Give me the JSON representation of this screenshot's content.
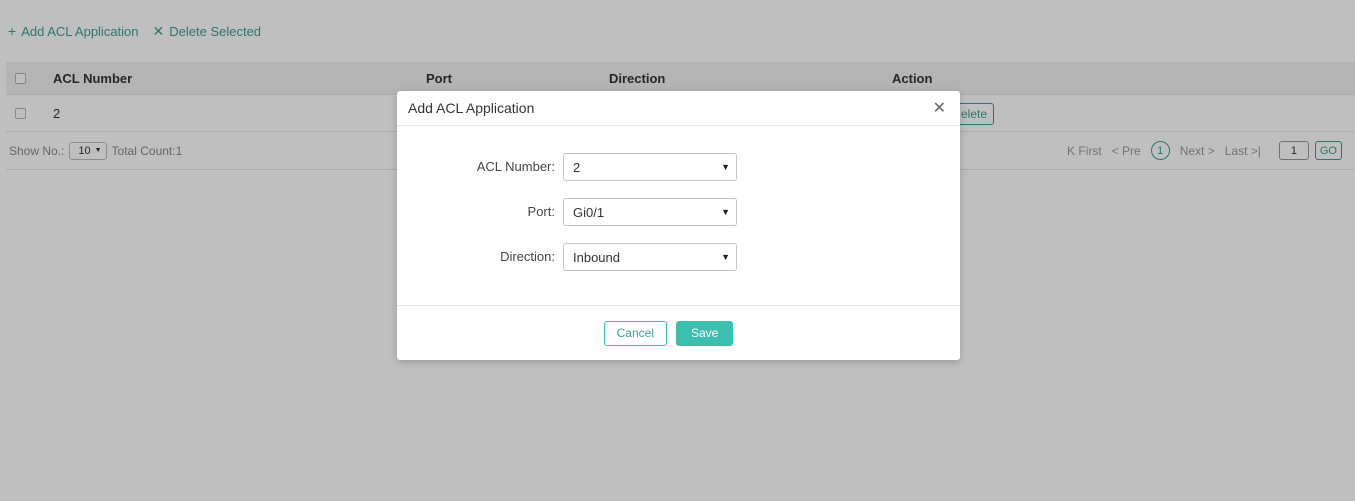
{
  "toolbar": {
    "add_icon": "+",
    "add_label": "Add ACL Application",
    "delete_icon": "✕",
    "delete_label": "Delete Selected"
  },
  "table": {
    "headers": [
      "ACL Number",
      "Port",
      "Direction",
      "Action"
    ],
    "rows": [
      {
        "acl_number": "2",
        "action_label": "elete"
      }
    ]
  },
  "pager": {
    "show_label": "Show No.:",
    "page_size": "10",
    "total": "Total Count:1",
    "first": "K First",
    "pre": "< Pre",
    "current": "1",
    "next": "Next >",
    "last": "Last >|",
    "input_value": "1",
    "go": "GO"
  },
  "modal": {
    "title": "Add ACL Application",
    "close_icon": "✕",
    "fields": [
      {
        "label": "ACL Number:",
        "value": "2"
      },
      {
        "label": "Port:",
        "value": "Gi0/1"
      },
      {
        "label": "Direction:",
        "value": "Inbound"
      }
    ],
    "cancel": "Cancel",
    "save": "Save"
  },
  "colors": {
    "accent": "#3b9e93",
    "save_bg": "#3bbfae"
  },
  "icons": {
    "dropdown": "▼"
  }
}
